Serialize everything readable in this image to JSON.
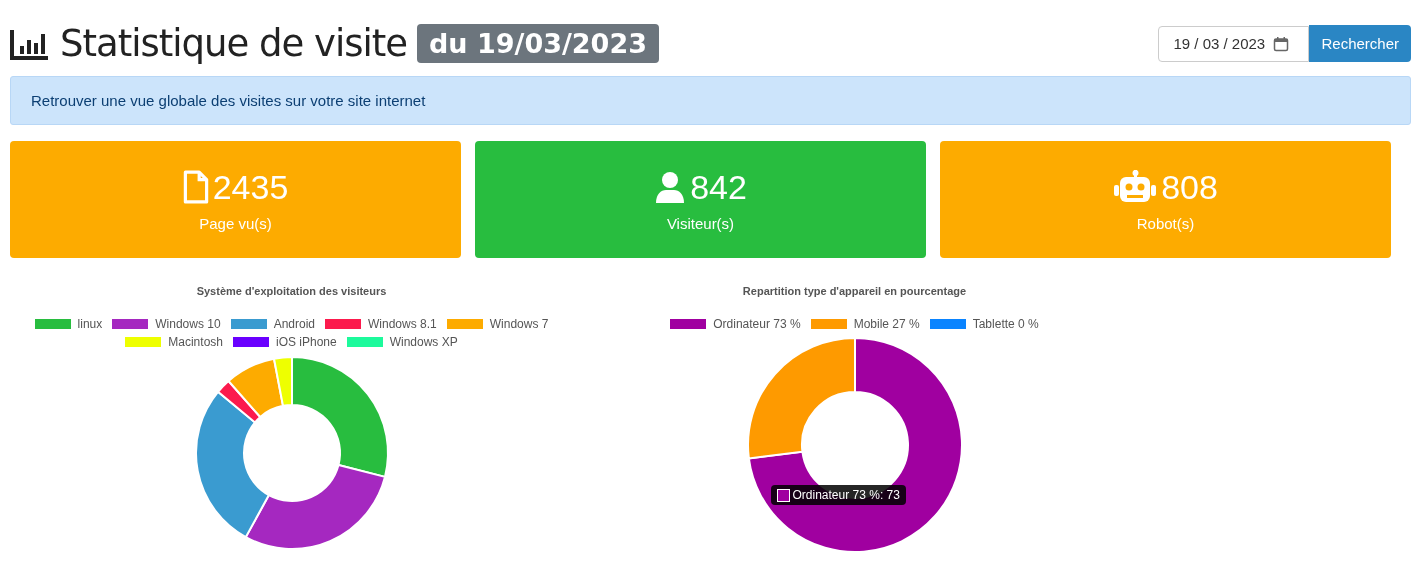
{
  "header": {
    "title": "Statistique de visite",
    "date_badge": "du 19/03/2023",
    "date_field": {
      "value": "19 / 03 / 2023"
    },
    "search_button": "Rechercher"
  },
  "info_banner": "Retrouver une vue globale des visites sur votre site internet",
  "stat_cards": [
    {
      "kind": "pages",
      "value": "2435",
      "label": "Page vu(s)",
      "color": "#fdab00"
    },
    {
      "kind": "visitors",
      "value": "842",
      "label": "Visiteur(s)",
      "color": "#28bd3f"
    },
    {
      "kind": "robots",
      "value": "808",
      "label": "Robot(s)",
      "color": "#fdab00"
    }
  ],
  "os_chart": {
    "title": "Système d'exploitation des visiteurs",
    "legend": [
      {
        "label": "linux",
        "color": "#28bd3f"
      },
      {
        "label": "Windows 10",
        "color": "#a528c0"
      },
      {
        "label": "Android",
        "color": "#3a9bd0"
      },
      {
        "label": "Windows 8.1",
        "color": "#fc1a4d"
      },
      {
        "label": "Windows 7",
        "color": "#fdab00"
      },
      {
        "label": "Macintosh",
        "color": "#eeff00"
      },
      {
        "label": "iOS iPhone",
        "color": "#6a00ff"
      },
      {
        "label": "Windows XP",
        "color": "#1dfa9c"
      }
    ]
  },
  "device_chart": {
    "chart_data": {
      "type": "donut",
      "title": "Repartition type d'appareil en pourcentage",
      "categories": [
        "Ordinateur 73 %",
        "Mobile 27 %",
        "Tablette 0 %"
      ],
      "colors": [
        "#a000a0",
        "#fe9a00",
        "#0a84ff"
      ],
      "legend": true,
      "series": [
        {
          "values": [
            73,
            27,
            0
          ]
        }
      ]
    },
    "tooltip": {
      "text": "Ordinateur 73 %: 73",
      "color": "#a000a0"
    }
  }
}
